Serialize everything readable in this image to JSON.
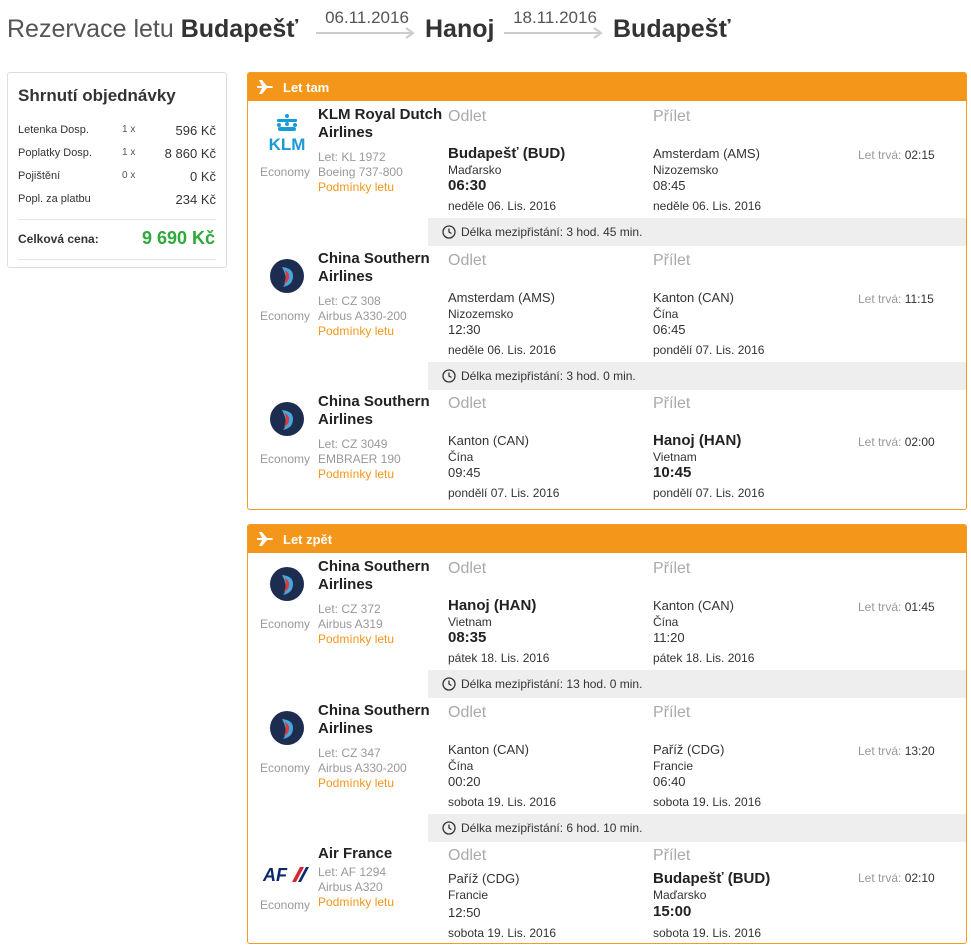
{
  "header": {
    "title_prefix": "Rezervace letu",
    "from_city": "Budapešť",
    "out_date": "06.11.2016",
    "dest_city": "Hanoj",
    "ret_date": "18.11.2016",
    "back_city": "Budapešť"
  },
  "summary": {
    "title": "Shrnutí objednávky",
    "rows": [
      {
        "label": "Letenka Dosp.",
        "qty": "1 x",
        "amount": "596 Kč"
      },
      {
        "label": "Poplatky Dosp.",
        "qty": "1 x",
        "amount": "8 860 Kč"
      },
      {
        "label": "Pojištění",
        "qty": "0 x",
        "amount": "0 Kč"
      },
      {
        "label": "Popl. za platbu",
        "qty": "",
        "amount": "234 Kč"
      }
    ],
    "total_label": "Celková cena:",
    "total_amount": "9 690 Kč",
    "total_color": "#2fa93a"
  },
  "colors": {
    "accent": "#f39619",
    "layover_bg": "#eeeeee"
  },
  "labels": {
    "departure": "Odlet",
    "arrival": "Přílet",
    "duration": "Let trvá:",
    "conditions": "Podmínky letu",
    "economy": "Economy",
    "layover": "Délka mezipřistání:"
  },
  "outbound": {
    "title": "Let tam",
    "icon": "plane-icon",
    "legs": [
      {
        "airline": "KLM Royal Dutch Airlines",
        "logo": "klm-logo",
        "flight": "Let: KL 1972",
        "aircraft": "Boeing 737-800",
        "dep": {
          "place": "Budapešť (BUD)",
          "country": "Maďarsko",
          "time": "06:30",
          "date": "neděle 06. Lis. 2016",
          "emph": true
        },
        "arr": {
          "place": "Amsterdam (AMS)",
          "country": "Nizozemsko",
          "time": "08:45",
          "date": "neděle 06. Lis. 2016",
          "emph": false
        },
        "duration": "02:15",
        "layover": "3 hod. 45 min."
      },
      {
        "airline": "China Southern Airlines",
        "logo": "china-southern-logo",
        "flight": "Let: CZ 308",
        "aircraft": "Airbus A330-200",
        "dep": {
          "place": "Amsterdam (AMS)",
          "country": "Nizozemsko",
          "time": "12:30",
          "date": "neděle 06. Lis. 2016",
          "emph": false
        },
        "arr": {
          "place": "Kanton (CAN)",
          "country": "Čína",
          "time": "06:45",
          "date": "pondělí 07. Lis. 2016",
          "emph": false
        },
        "duration": "11:15",
        "layover": "3 hod. 0 min."
      },
      {
        "airline": "China Southern Airlines",
        "logo": "china-southern-logo",
        "flight": "Let: CZ 3049",
        "aircraft": "EMBRAER 190",
        "dep": {
          "place": "Kanton (CAN)",
          "country": "Čína",
          "time": "09:45",
          "date": "pondělí 07. Lis. 2016",
          "emph": false
        },
        "arr": {
          "place": "Hanoj (HAN)",
          "country": "Vietnam",
          "time": "10:45",
          "date": "pondělí 07. Lis. 2016",
          "emph": true
        },
        "duration": "02:00",
        "layover": ""
      }
    ]
  },
  "inbound": {
    "title": "Let zpět",
    "icon": "plane-icon",
    "legs": [
      {
        "airline": "China Southern Airlines",
        "logo": "china-southern-logo",
        "flight": "Let: CZ 372",
        "aircraft": "Airbus A319",
        "dep": {
          "place": "Hanoj (HAN)",
          "country": "Vietnam",
          "time": "08:35",
          "date": "pátek 18. Lis. 2016",
          "emph": true
        },
        "arr": {
          "place": "Kanton (CAN)",
          "country": "Čína",
          "time": "11:20",
          "date": "pátek 18. Lis. 2016",
          "emph": false
        },
        "duration": "01:45",
        "layover": "13 hod. 0 min."
      },
      {
        "airline": "China Southern Airlines",
        "logo": "china-southern-logo",
        "flight": "Let: CZ 347",
        "aircraft": "Airbus A330-200",
        "dep": {
          "place": "Kanton (CAN)",
          "country": "Čína",
          "time": "00:20",
          "date": "sobota 19. Lis. 2016",
          "emph": false
        },
        "arr": {
          "place": "Paříž (CDG)",
          "country": "Francie",
          "time": "06:40",
          "date": "sobota 19. Lis. 2016",
          "emph": false
        },
        "duration": "13:20",
        "layover": "6 hod. 10 min."
      },
      {
        "airline": "Air France",
        "logo": "air-france-logo",
        "flight": "Let: AF 1294",
        "aircraft": "Airbus A320",
        "dep": {
          "place": "Paříž (CDG)",
          "country": "Francie",
          "time": "12:50",
          "date": "sobota 19. Lis. 2016",
          "emph": false
        },
        "arr": {
          "place": "Budapešť (BUD)",
          "country": "Maďarsko",
          "time": "15:00",
          "date": "sobota 19. Lis. 2016",
          "emph": true
        },
        "duration": "02:10",
        "layover": ""
      }
    ]
  }
}
